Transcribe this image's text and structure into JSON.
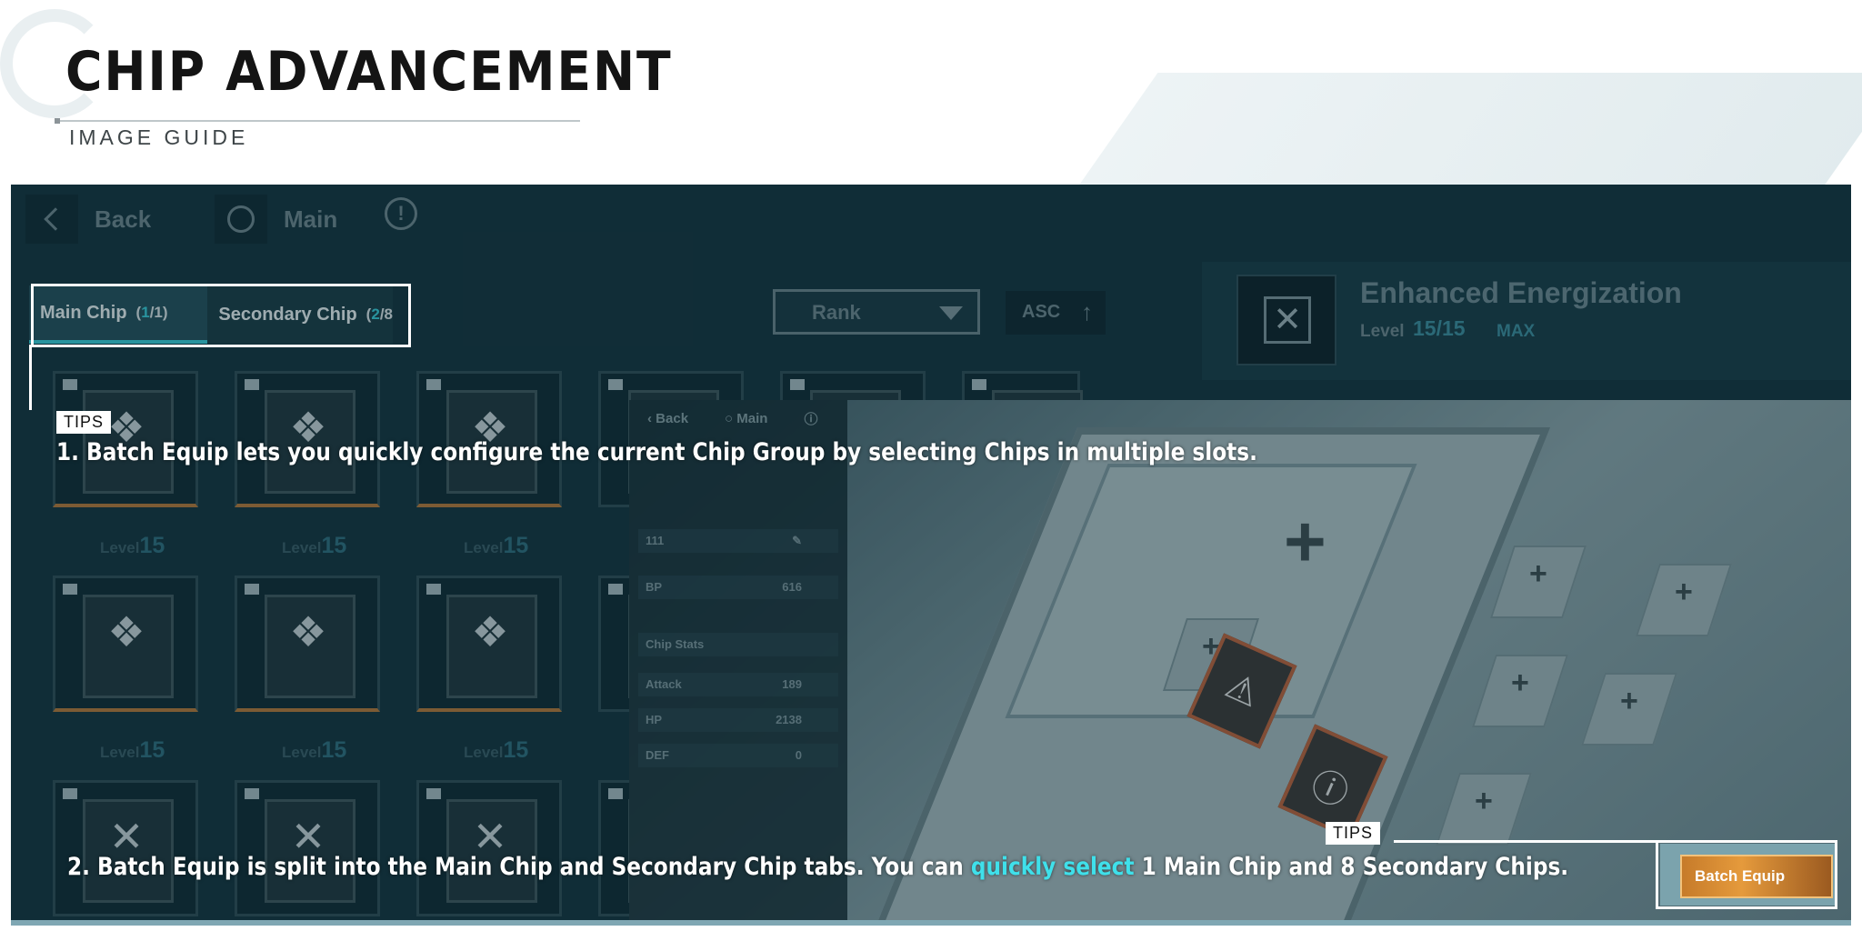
{
  "header": {
    "title": "CHIP ADVANCEMENT",
    "subtitle": "IMAGE GUIDE"
  },
  "game_nav": {
    "back_label": "Back",
    "main_label": "Main",
    "info_icon": "info-icon"
  },
  "tabs": [
    {
      "label": "Main Chip",
      "count_current": "1",
      "count_total": "/1)",
      "count_open": "("
    },
    {
      "label": "Secondary Chip",
      "count_current": "2",
      "count_total": "/8",
      "count_open": "("
    }
  ],
  "sort": {
    "rank_label": "Rank",
    "order_label": "ASC"
  },
  "selected_chip": {
    "name": "Enhanced Energization",
    "level_label": "Level",
    "level": "15/15",
    "max_label": "MAX"
  },
  "chip_grid": {
    "level_label": "Level",
    "level_value": "15"
  },
  "preview": {
    "back_label": "Back",
    "main_label": "Main",
    "name_value": "111",
    "bp_label": "BP",
    "bp_value": "616",
    "stats_label": "Chip Stats",
    "attack_label": "Attack",
    "attack_value": "189",
    "hp_label": "HP",
    "hp_value": "2138",
    "def_label": "DEF",
    "def_value": "0"
  },
  "tips": [
    {
      "label": "TIPS",
      "text": "1. Batch Equip lets you quickly configure the current Chip Group by selecting Chips in multiple slots."
    },
    {
      "label": "TIPS",
      "text_before": "2. Batch Equip is split into the Main Chip and Secondary Chip tabs. You can ",
      "highlight": "quickly select",
      "text_after": " 1 Main Chip and 8 Secondary Chips."
    }
  ],
  "batch_equip": {
    "label": "Batch Equip"
  },
  "colors": {
    "accent": "#3ad1dd",
    "highlight_text": "#3fe0ea",
    "panel_bg": "#13333e",
    "batch_button": "#e59a3c"
  }
}
